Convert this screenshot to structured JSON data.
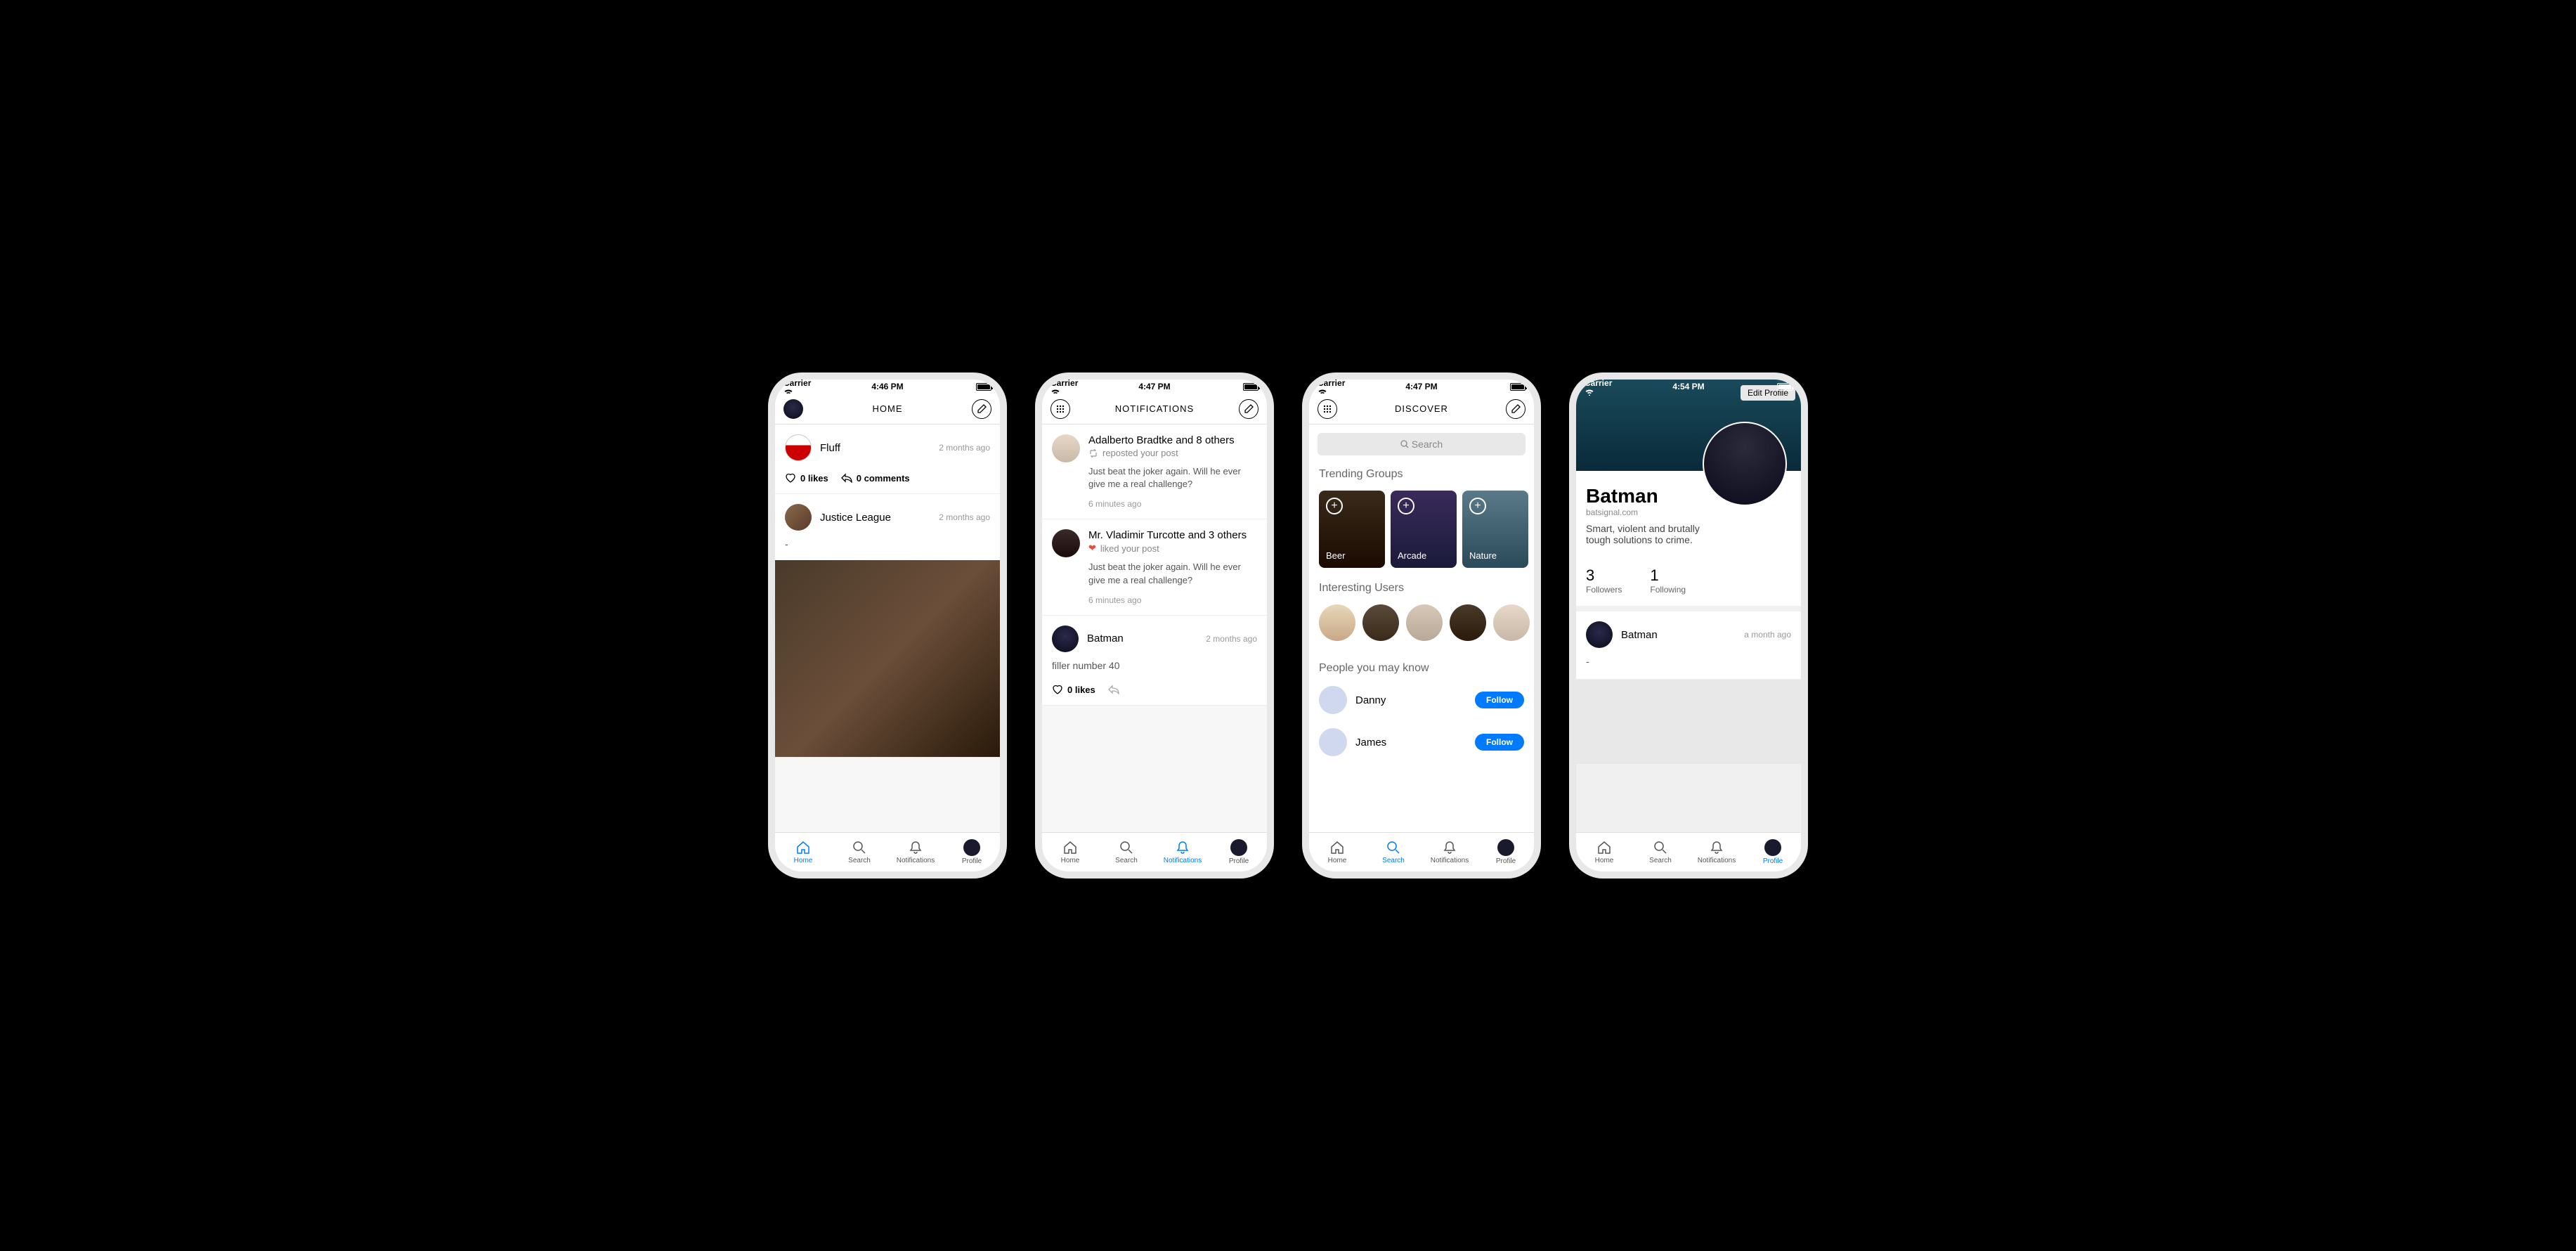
{
  "status": {
    "carrier": "Carrier",
    "signal": "≈"
  },
  "tabs": {
    "home": "Home",
    "search": "Search",
    "notifications": "Notifications",
    "profile": "Profile"
  },
  "screen1": {
    "time": "4:46 PM",
    "title": "HOME",
    "posts": [
      {
        "name": "Fluff",
        "time": "2 months ago",
        "likes": "0 likes",
        "comments": "0 comments",
        "body": ""
      },
      {
        "name": "Justice League",
        "time": "2 months ago",
        "body": "-"
      }
    ]
  },
  "screen2": {
    "time": "4:47 PM",
    "title": "NOTIFICATIONS",
    "items": [
      {
        "title": "Adalberto Bradtke and 8 others",
        "sub": "reposted your post",
        "content": "Just beat the joker again. Will he ever give me a real challenge?",
        "time": "6 minutes ago",
        "icon": "repost"
      },
      {
        "title": "Mr. Vladimir Turcotte and 3 others",
        "sub": "liked your post",
        "content": "Just beat the joker again. Will he ever give me a real challenge?",
        "time": "6 minutes ago",
        "icon": "heart"
      }
    ],
    "post": {
      "name": "Batman",
      "time": "2 months ago",
      "body": "filler number 40",
      "likes": "0 likes"
    }
  },
  "screen3": {
    "time": "4:47 PM",
    "title": "DISCOVER",
    "search_placeholder": "Search",
    "trending_title": "Trending Groups",
    "groups": [
      "Beer",
      "Arcade",
      "Nature"
    ],
    "users_title": "Interesting Users",
    "pymk_title": "People you may know",
    "pymk": [
      {
        "name": "Danny",
        "btn": "Follow"
      },
      {
        "name": "James",
        "btn": "Follow"
      }
    ]
  },
  "screen4": {
    "time": "4:54 PM",
    "edit_btn": "Edit Profile",
    "name": "Batman",
    "url": "batsignal.com",
    "bio": "Smart, violent and brutally tough solutions to crime.",
    "followers_n": "3",
    "followers_l": "Followers",
    "following_n": "1",
    "following_l": "Following",
    "post": {
      "name": "Batman",
      "time": "a month ago",
      "body": "-"
    }
  }
}
